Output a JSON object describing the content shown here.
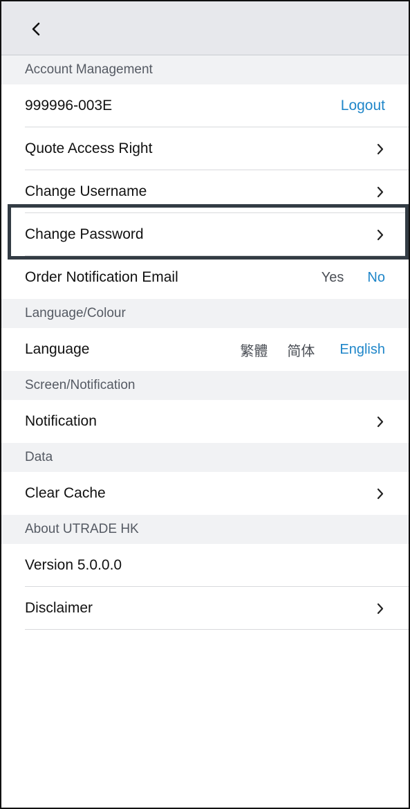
{
  "nav": {
    "back_icon": "chevron-left-icon"
  },
  "account": {
    "header": "Account Management",
    "account_id": "999996-003E",
    "logout": "Logout",
    "quote_access": "Quote Access Right",
    "change_username": "Change Username",
    "change_password": "Change Password",
    "order_email_label": "Order Notification Email",
    "order_email_yes": "Yes",
    "order_email_no": "No"
  },
  "language_colour": {
    "header": "Language/Colour",
    "language_label": "Language",
    "options": [
      "繁體",
      "简体",
      "English"
    ],
    "selected": "English"
  },
  "screen_notification": {
    "header": "Screen/Notification",
    "notification": "Notification"
  },
  "data_section": {
    "header": "Data",
    "clear_cache": "Clear Cache"
  },
  "about": {
    "header": "About UTRADE HK",
    "version": "Version 5.0.0.0",
    "disclaimer": "Disclaimer"
  },
  "colors": {
    "accent_blue": "#1f86c9",
    "highlight_border": "#333c44",
    "section_bg": "#f1f2f4",
    "nav_bg": "#e7e8ec"
  }
}
